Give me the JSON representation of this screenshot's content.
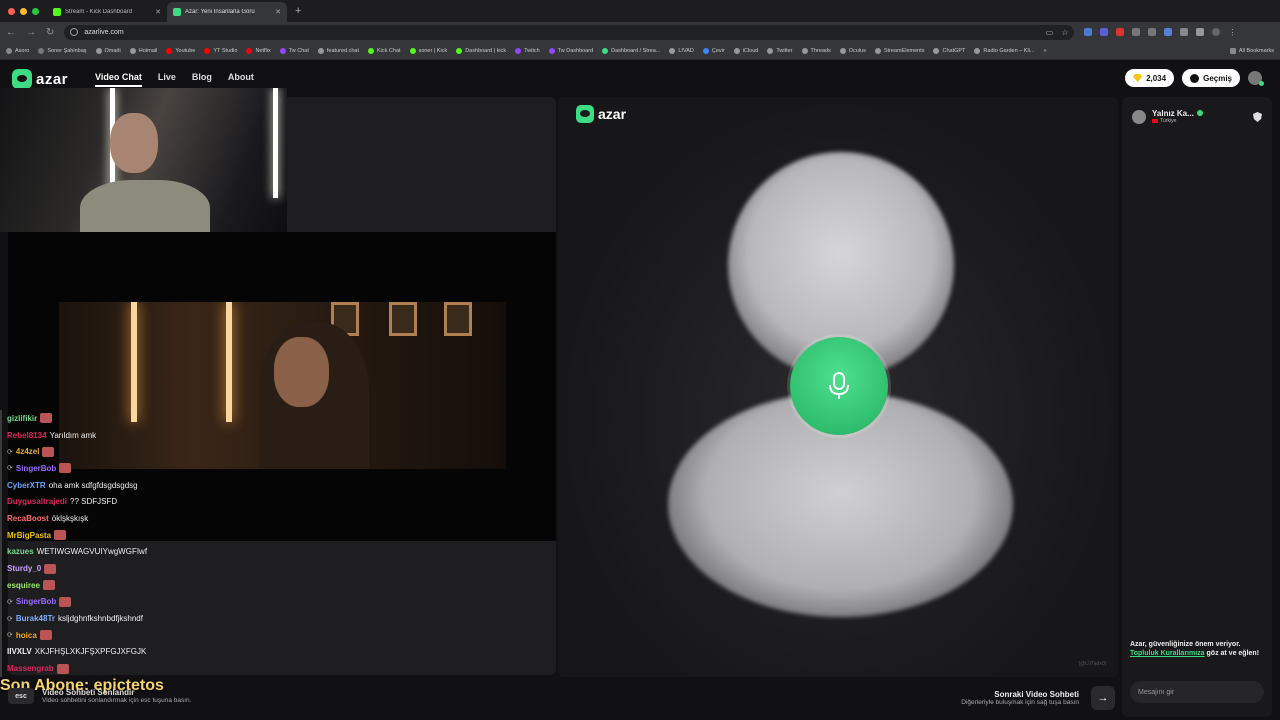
{
  "browser": {
    "tabs": [
      {
        "title": "Stream - Kick Dashboard",
        "favicon_color": "#53fc18",
        "active": false
      },
      {
        "title": "Azar: Yeni İnsanlarla Görü",
        "favicon_color": "#3ddc84",
        "active": true
      }
    ],
    "url": "azarlive.com",
    "bookmarks": [
      {
        "label": "Asoro",
        "color": "#888"
      },
      {
        "label": "Soner Şahinbaş",
        "color": "#777"
      },
      {
        "label": "Omadi",
        "color": "#999"
      },
      {
        "label": "Hotmail",
        "color": "#999"
      },
      {
        "label": "Youtube",
        "color": "#ff0000"
      },
      {
        "label": "YT Studio",
        "color": "#ff0000"
      },
      {
        "label": "Netflix",
        "color": "#e50914"
      },
      {
        "label": "Tw Chat",
        "color": "#9146ff"
      },
      {
        "label": "featured.chat",
        "color": "#999"
      },
      {
        "label": "Kick Chat",
        "color": "#53fc18"
      },
      {
        "label": "soner | Kick",
        "color": "#53fc18"
      },
      {
        "label": "Dashboard | kick",
        "color": "#53fc18"
      },
      {
        "label": "Twitch",
        "color": "#9146ff"
      },
      {
        "label": "Tw Dashboard",
        "color": "#9146ff"
      },
      {
        "label": "Dashboard / Strea...",
        "color": "#3ddc84"
      },
      {
        "label": "LIVAD",
        "color": "#999"
      },
      {
        "label": "Çevir",
        "color": "#4285f4"
      },
      {
        "label": "iCloud",
        "color": "#999"
      },
      {
        "label": "Twitter",
        "color": "#999"
      },
      {
        "label": "Threads",
        "color": "#999"
      },
      {
        "label": "Oculus",
        "color": "#999"
      },
      {
        "label": "StreamElements",
        "color": "#999"
      },
      {
        "label": "ChatGPT",
        "color": "#999"
      },
      {
        "label": "Radio Garden – Kli...",
        "color": "#999"
      }
    ],
    "more_bookmarks": "»",
    "all_bookmarks": "All Bookmarks"
  },
  "site": {
    "logo": "azar",
    "nav": [
      "Video Chat",
      "Live",
      "Blog",
      "About"
    ],
    "gems": "2,034",
    "history_label": "Geçmiş"
  },
  "chat": {
    "messages": [
      {
        "user": "gizlifikir",
        "color": "#7bd88f",
        "text": "",
        "emote": true,
        "icon": ""
      },
      {
        "user": "Rebel8134",
        "color": "#e0245e",
        "text": "Yarıldım amk",
        "emote": false,
        "icon": ""
      },
      {
        "user": "4z4zel",
        "color": "#e5a940",
        "text": "",
        "emote": true,
        "icon": "⟳"
      },
      {
        "user": "SingerBob",
        "color": "#9a6bff",
        "text": "",
        "emote": true,
        "icon": "⟳"
      },
      {
        "user": "CyberXTR",
        "color": "#6aa8ff",
        "text": "oha amk sdfgfdsgdsgdsg",
        "emote": false,
        "icon": ""
      },
      {
        "user": "Duygusaltrajedi",
        "color": "#e0245e",
        "text": "?? SDFJSFD",
        "emote": false,
        "icon": ""
      },
      {
        "user": "RecaBoost",
        "color": "#ff6b6b",
        "text": "öklşkşkışk",
        "emote": false,
        "icon": ""
      },
      {
        "user": "MrBigPasta",
        "color": "#f1c40f",
        "text": "",
        "emote": true,
        "icon": ""
      },
      {
        "user": "kazues",
        "color": "#7bd88f",
        "text": "WETIWGWAGVUIYwgWGFIwf",
        "emote": false,
        "icon": ""
      },
      {
        "user": "Sturdy_0",
        "color": "#c9a0ff",
        "text": "",
        "emote": true,
        "icon": ""
      },
      {
        "user": "esquiree",
        "color": "#9be86d",
        "text": "",
        "emote": true,
        "icon": ""
      },
      {
        "user": "SingerBob",
        "color": "#9a6bff",
        "text": "",
        "emote": true,
        "icon": "⟳"
      },
      {
        "user": "Burak48Tr",
        "color": "#7fb0ff",
        "text": "ksljdghnfkshnbdfjkshndf",
        "emote": false,
        "icon": "⟳"
      },
      {
        "user": "hoica",
        "color": "#f5a623",
        "text": "",
        "emote": true,
        "icon": "⟳"
      },
      {
        "user": "IIVXLV",
        "color": "#eeeeee",
        "text": "XKJFHŞLXKJFŞXPFGJXFGJK",
        "emote": false,
        "icon": ""
      },
      {
        "user": "Massengrab",
        "color": "#e0245e",
        "text": "",
        "emote": true,
        "icon": ""
      }
    ]
  },
  "overlay": {
    "last_sub": "Son Abone: epictetos"
  },
  "esc": {
    "key": "esc",
    "title": "Video Sohbeti Sonlandır",
    "desc": "Video sohbetini sonlandırmak için esc tuşuna basın."
  },
  "center": {
    "logo": "azar",
    "watermark": "[@UJTadx0]"
  },
  "next": {
    "title": "Sonraki Video Sohbeti",
    "desc": "Diğerleriyle buluşmak için sağ tuşa basın",
    "arrow": "→"
  },
  "partner": {
    "name": "Yalnız Ka...",
    "country": "Türkiye"
  },
  "safety": {
    "pre": "Azar, güvenliğinize önem veriyor.",
    "link": "Topluluk Kurallarımıza",
    "post": "göz at ve eğlen!"
  },
  "message_input": {
    "placeholder": "Mesajını gir"
  }
}
